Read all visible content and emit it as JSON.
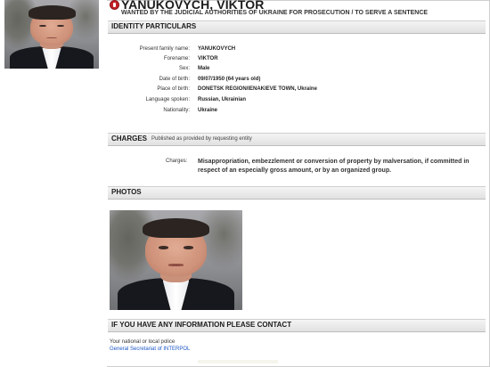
{
  "header": {
    "name": "YANUKOVYCH, VIKTOR",
    "subtitle": "WANTED BY THE JUDICIAL AUTHORITIES OF UKRAINE FOR PROSECUTION / TO SERVE A SENTENCE"
  },
  "sections": {
    "identity": "IDENTITY PARTICULARS",
    "charges": "CHARGES",
    "charges_note": "Published as provided by requesting entity",
    "photos": "PHOTOS",
    "contact": "IF YOU HAVE ANY INFORMATION PLEASE CONTACT"
  },
  "identity": [
    {
      "label": "Present family name:",
      "value": "YANUKOVYCH"
    },
    {
      "label": "Forename:",
      "value": "VIKTOR"
    },
    {
      "label": "Sex:",
      "value": "Male"
    },
    {
      "label": "Date of birth:",
      "value": "09/07/1950 (64 years old)"
    },
    {
      "label": "Place of birth:",
      "value": "DONETSK REGION/IENAKIEVE TOWN, Ukraine"
    },
    {
      "label": "Language spoken:",
      "value": "Russian, Ukrainian"
    },
    {
      "label": "Nationality:",
      "value": "Ukraine"
    }
  ],
  "charges": {
    "label": "Charges:",
    "text": "Misappropriation, embezzlement or conversion of property by malversation, if committed in respect of an especially gross amount, or by an organized group."
  },
  "contact": {
    "line1": "Your national or local police",
    "link": "General Secretariat of INTERPOL"
  },
  "icons": {
    "seal": "interpol-red-notice-icon"
  },
  "colors": {
    "notice_red": "#c32127",
    "link_blue": "#1d57c7"
  }
}
